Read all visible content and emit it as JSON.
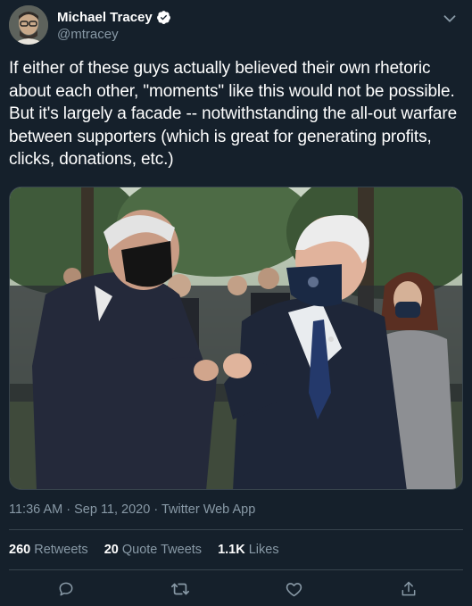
{
  "tweet": {
    "author": {
      "display_name": "Michael Tracey",
      "handle": "@mtracey",
      "verified": true
    },
    "text": "If either of these guys actually believed their own rhetoric about each other, \"moments\" like this would not be possible. But it's largely a facade -- notwithstanding the all-out warfare between supporters (which is great for generating profits, clicks, donations, etc.)",
    "meta": {
      "time": "11:36 AM",
      "separator": "·",
      "date": "Sep 11, 2020",
      "source": "Twitter Web App"
    },
    "stats": {
      "retweets_count": "260",
      "retweets_label": "Retweets",
      "quote_count": "20",
      "quote_label": "Quote Tweets",
      "likes_count": "1.1K",
      "likes_label": "Likes"
    }
  },
  "icons": {
    "verified": "verified-badge-icon",
    "more": "chevron-down-icon",
    "reply": "reply-icon",
    "retweet": "retweet-icon",
    "like": "heart-icon",
    "share": "share-icon"
  },
  "colors": {
    "background": "#15202b",
    "text_secondary": "#8899a6",
    "divider": "#38444d"
  }
}
